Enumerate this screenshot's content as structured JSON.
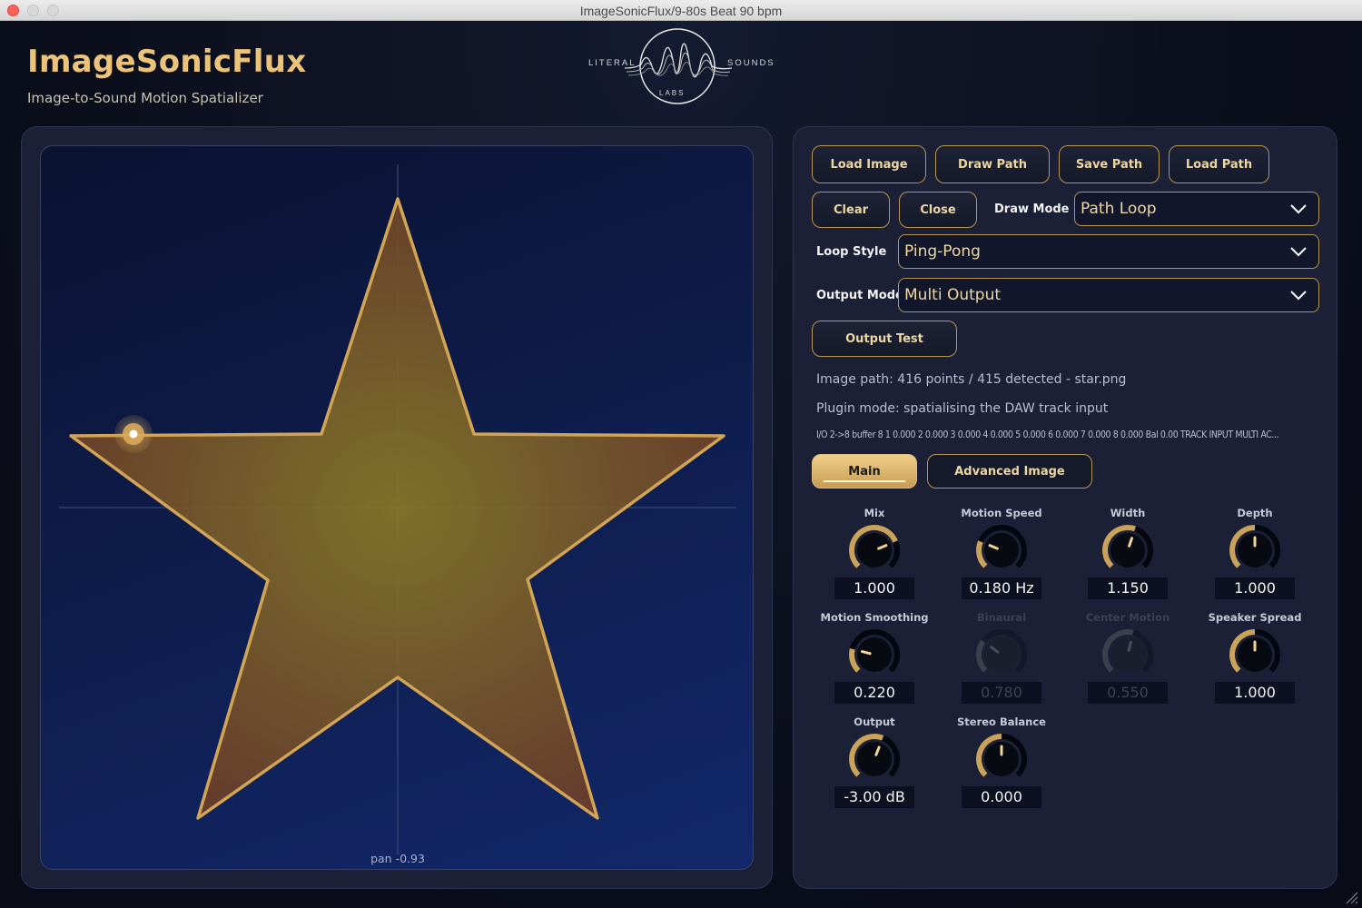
{
  "window": {
    "title": "ImageSonicFlux/9-80s Beat 90 bpm"
  },
  "header": {
    "title": "ImageSonicFlux",
    "subtitle": "Image-to-Sound Motion Spatializer",
    "logo": {
      "left": "LITERAL",
      "right": "SOUNDS",
      "bottom": "LABS"
    }
  },
  "canvas": {
    "pan_label": "pan -0.93",
    "shape": "star"
  },
  "toolbar": {
    "load_image": "Load Image",
    "draw_path": "Draw Path",
    "save_path": "Save Path",
    "load_path": "Load Path",
    "clear": "Clear",
    "close": "Close",
    "draw_mode_label": "Draw Mode",
    "draw_mode_value": "Path Loop",
    "loop_style_label": "Loop Style",
    "loop_style_value": "Ping-Pong",
    "output_mode_label": "Output Mode",
    "output_mode_value": "Multi Output",
    "output_test": "Output Test"
  },
  "status": {
    "image_path": "Image path: 416 points / 415 detected - star.png",
    "plugin_mode": "Plugin mode: spatialising the DAW track input",
    "io": "I/O 2->8  buffer 8  1 0.000  2 0.000  3 0.000  4 0.000  5 0.000  6 0.000  7 0.000  8 0.000  Bal 0.00  TRACK INPUT  MULTI AC..."
  },
  "tabs": {
    "main": "Main",
    "advanced": "Advanced Image"
  },
  "knobs": [
    {
      "name": "Mix",
      "value": "1.000",
      "level": 0.75,
      "enabled": true
    },
    {
      "name": "Motion Speed",
      "value": "0.180 Hz",
      "level": 0.25,
      "enabled": true
    },
    {
      "name": "Width",
      "value": "1.150",
      "level": 0.57,
      "enabled": true
    },
    {
      "name": "Depth",
      "value": "1.000",
      "level": 0.5,
      "enabled": true
    },
    {
      "name": "Motion Smoothing",
      "value": "0.220",
      "level": 0.22,
      "enabled": true
    },
    {
      "name": "Binaural",
      "value": "0.780",
      "level": 0.3,
      "enabled": false
    },
    {
      "name": "Center Motion",
      "value": "0.550",
      "level": 0.55,
      "enabled": false
    },
    {
      "name": "Speaker Spread",
      "value": "1.000",
      "level": 0.5,
      "enabled": true
    },
    {
      "name": "Output",
      "value": "-3.00 dB",
      "level": 0.58,
      "enabled": true
    },
    {
      "name": "Stereo Balance",
      "value": "0.000",
      "level": 0.5,
      "enabled": true
    }
  ],
  "colors": {
    "accent": "#c9a35a",
    "panel": "#1b2036",
    "background": "#0b0e1b"
  }
}
